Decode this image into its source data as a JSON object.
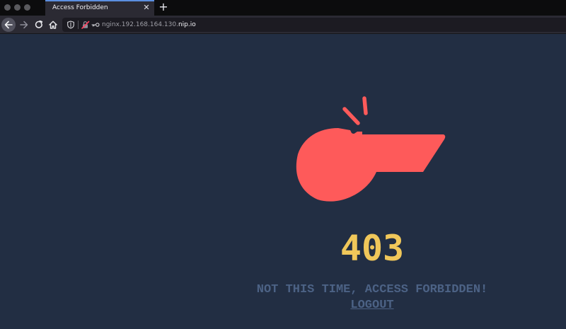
{
  "browser": {
    "tab_title": "Access Forbidden",
    "tab_close_glyph": "✕",
    "new_tab_glyph": "+",
    "url_host": "nginx.192.168.164.130.",
    "url_domain": "nip.io"
  },
  "page": {
    "code": "403",
    "message": "NOT THIS TIME, ACCESS FORBIDDEN!",
    "logout_label": "LOGOUT"
  },
  "colors": {
    "background": "#222e43",
    "whistle": "#fe5a5a",
    "code": "#f0c75a",
    "message": "#4c6285"
  },
  "icons": {
    "back": "back-arrow-icon",
    "forward": "forward-arrow-icon",
    "reload": "reload-icon",
    "home": "home-icon",
    "tracking": "shield-icon",
    "site_info": "broken-lock-icon",
    "key": "key-icon",
    "illustration": "whistle-icon"
  }
}
